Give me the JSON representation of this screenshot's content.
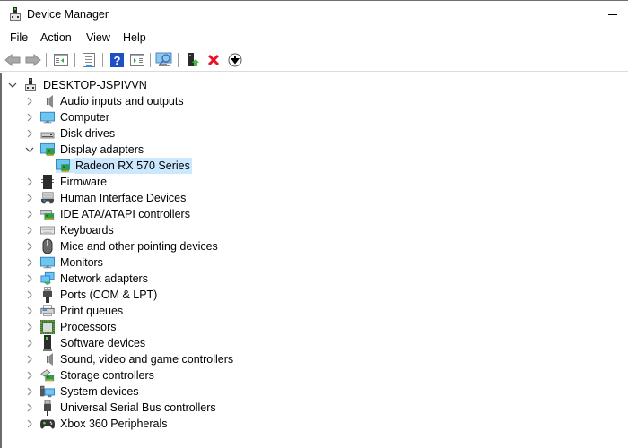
{
  "window": {
    "title": "Device Manager",
    "app_icon": "device-manager-icon",
    "controls": [
      "minimize-icon"
    ]
  },
  "menu": [
    "File",
    "Action",
    "View",
    "Help"
  ],
  "toolbar": {
    "buttons": [
      {
        "name": "back",
        "icon": "arrow-left-icon",
        "enabled": false
      },
      {
        "name": "forward",
        "icon": "arrow-right-icon",
        "enabled": false
      },
      {
        "name": "show-hide-console-tree",
        "icon": "console-tree-icon"
      },
      {
        "name": "properties",
        "icon": "properties-icon"
      },
      {
        "name": "help",
        "icon": "help-icon"
      },
      {
        "name": "show-action-pane",
        "icon": "action-pane-icon"
      },
      {
        "name": "scan-hardware-changes",
        "icon": "scan-monitor-icon"
      },
      {
        "name": "update-driver",
        "icon": "update-driver-icon"
      },
      {
        "name": "uninstall-device",
        "icon": "red-x-icon"
      },
      {
        "name": "disable-device",
        "icon": "down-arrow-circle-icon"
      }
    ]
  },
  "tree": {
    "root": {
      "label": "DESKTOP-JSPIVVN",
      "expanded": true,
      "icon": "computer-tower-icon"
    },
    "categories": [
      {
        "label": "Audio inputs and outputs",
        "icon": "speaker-icon",
        "expanded": false
      },
      {
        "label": "Computer",
        "icon": "monitor-icon",
        "expanded": false
      },
      {
        "label": "Disk drives",
        "icon": "disk-drive-icon",
        "expanded": false
      },
      {
        "label": "Display adapters",
        "icon": "display-adapter-icon",
        "expanded": true,
        "children": [
          {
            "label": "Radeon RX 570 Series",
            "icon": "display-adapter-icon",
            "selected": true
          }
        ]
      },
      {
        "label": "Firmware",
        "icon": "chip-icon",
        "expanded": false
      },
      {
        "label": "Human Interface Devices",
        "icon": "hid-icon",
        "expanded": false
      },
      {
        "label": "IDE ATA/ATAPI controllers",
        "icon": "ide-controller-icon",
        "expanded": false
      },
      {
        "label": "Keyboards",
        "icon": "keyboard-icon",
        "expanded": false
      },
      {
        "label": "Mice and other pointing devices",
        "icon": "mouse-icon",
        "expanded": false
      },
      {
        "label": "Monitors",
        "icon": "monitor-icon",
        "expanded": false
      },
      {
        "label": "Network adapters",
        "icon": "network-adapter-icon",
        "expanded": false
      },
      {
        "label": "Ports (COM & LPT)",
        "icon": "port-icon",
        "expanded": false
      },
      {
        "label": "Print queues",
        "icon": "printer-icon",
        "expanded": false
      },
      {
        "label": "Processors",
        "icon": "processor-icon",
        "expanded": false
      },
      {
        "label": "Software devices",
        "icon": "software-device-icon",
        "expanded": false
      },
      {
        "label": "Sound, video and game controllers",
        "icon": "speaker-icon",
        "expanded": false
      },
      {
        "label": "Storage controllers",
        "icon": "storage-controller-icon",
        "expanded": false
      },
      {
        "label": "System devices",
        "icon": "system-devices-icon",
        "expanded": false
      },
      {
        "label": "Universal Serial Bus controllers",
        "icon": "usb-icon",
        "expanded": false
      },
      {
        "label": "Xbox 360 Peripherals",
        "icon": "gamepad-icon",
        "expanded": false
      }
    ]
  },
  "colors": {
    "selection": "#cce8ff",
    "uninstall_red": "#e81123",
    "help_blue": "#1e4fc6"
  }
}
